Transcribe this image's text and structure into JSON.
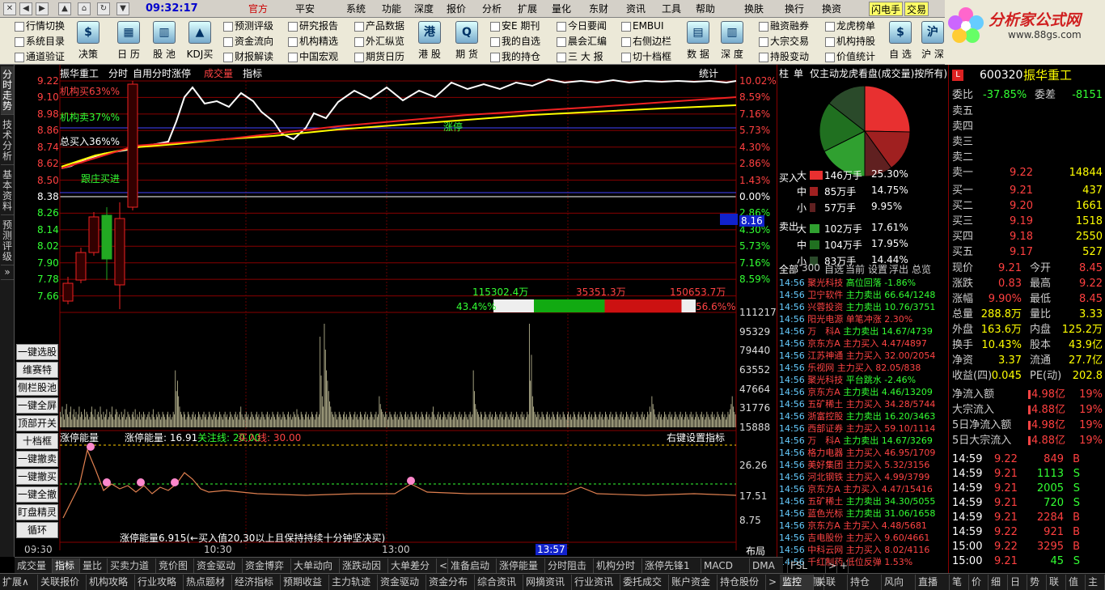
{
  "clock": "09:32:17",
  "menu": [
    {
      "label": "官方",
      "red": true,
      "hl": false
    },
    {
      "label": "平安",
      "red": false,
      "hl": false
    },
    {
      "label": "系统",
      "red": false,
      "hl": false
    },
    {
      "label": "功能",
      "red": false,
      "hl": false
    },
    {
      "label": "深度",
      "red": false,
      "hl": false
    },
    {
      "label": "报价",
      "red": false,
      "hl": false
    },
    {
      "label": "分析",
      "red": false,
      "hl": false
    },
    {
      "label": "扩展",
      "red": false,
      "hl": false
    },
    {
      "label": "量化",
      "red": false,
      "hl": false
    },
    {
      "label": "东财",
      "red": false,
      "hl": false
    },
    {
      "label": "资讯",
      "red": false,
      "hl": false
    },
    {
      "label": "工具",
      "red": false,
      "hl": false
    },
    {
      "label": "帮助",
      "red": false,
      "hl": false
    },
    {
      "label": "换肤",
      "red": false,
      "hl": false
    },
    {
      "label": "换行",
      "red": false,
      "hl": false
    },
    {
      "label": "换资",
      "red": false,
      "hl": false
    },
    {
      "label": "闪电手",
      "red": false,
      "hl": true
    },
    {
      "label": "交易",
      "red": false,
      "hl": true
    }
  ],
  "toolbar": {
    "checks": [
      [
        "行情切换",
        "系统目录",
        "通道验证"
      ],
      [
        "预测评级",
        "资金流向",
        "财报解读"
      ],
      [
        "研究报告",
        "机构精选",
        "中国宏观"
      ],
      [
        "产品数据",
        "外汇纵览",
        "期货日历"
      ],
      [
        "安E 期刊",
        "我的自选",
        "我的持仓"
      ],
      [
        "今日要闻",
        "晨会汇编",
        "三 大 报"
      ],
      [
        "EMBUI",
        "右侧边栏",
        "切十档框"
      ],
      [
        "融资融券",
        "大宗交易",
        "持股变动"
      ],
      [
        "龙虎榜单",
        "机构持股",
        "价值统计"
      ],
      [
        "K 点决策",
        "热点追击"
      ]
    ],
    "big": [
      "决策",
      "日 历",
      "股 池",
      "KDJ买",
      "港 股",
      "期 货",
      "数 据",
      "深 度",
      "自 选",
      "沪 深"
    ],
    "logo_main": "分析家公式网",
    "logo_sub": "www.88gs.com"
  },
  "sidetabs": [
    "分时走势",
    "技术分析",
    "基本资料",
    "预测评级"
  ],
  "leftbtns": [
    "一键选股",
    "维赛特",
    "侧栏股池",
    "一键全屏",
    "顶部开关",
    "十档框",
    "一键撤卖",
    "一键撤买",
    "一键全撤",
    "盯盘精灵",
    "循环N:01"
  ],
  "chart": {
    "header": [
      "振华重工",
      "分时",
      "自用分时涨停",
      "成交量",
      "指标"
    ],
    "stats_label": "统计",
    "price_ticks": [
      "9.22",
      "9.10",
      "8.98",
      "8.86",
      "8.74",
      "8.62",
      "8.50",
      "8.38",
      "8.26",
      "8.14",
      "8.02",
      "7.90",
      "7.78",
      "7.66"
    ],
    "pct_ticks": [
      "10.02%",
      "8.59%",
      "7.16%",
      "5.73%",
      "4.30%",
      "2.86%",
      "1.43%",
      "0.00%",
      "2.86%",
      "4.30%",
      "5.73%",
      "7.16%",
      "8.59%"
    ],
    "current_price": "8.16",
    "annotations": [
      "机构买63%%",
      "机构卖37%%",
      "总买入36%%",
      "跟庄买进",
      "涨停"
    ],
    "bar": {
      "left_val": "115302.4万",
      "mid_val": "35351.3万",
      "right_val": "150653.7万",
      "left_pct": "43.4%%",
      "right_pct": "56.6%%",
      "green_frac": 0.35,
      "red_frac": 0.38
    },
    "vol_ticks": [
      "111217",
      "95329",
      "79440",
      "63552",
      "47664",
      "31776",
      "15888"
    ],
    "vol_values": [
      6,
      4,
      8,
      5,
      3,
      7,
      9,
      5,
      4,
      6,
      8,
      3,
      5,
      7,
      4,
      6,
      3,
      5,
      8,
      4,
      6,
      5,
      3,
      7,
      4,
      6,
      5,
      3,
      4,
      6,
      8,
      5,
      4,
      7,
      3,
      5,
      6,
      4,
      8,
      5,
      3,
      6,
      4,
      5,
      7,
      3,
      4,
      6,
      5,
      8,
      4,
      3,
      5,
      7,
      6,
      4,
      5,
      3,
      6,
      4,
      5,
      7,
      3,
      4,
      6,
      5,
      4,
      3,
      5,
      6,
      4,
      7,
      3,
      5,
      4,
      6,
      3,
      5,
      4,
      6,
      5,
      3,
      4,
      5,
      6,
      4,
      3,
      5,
      7,
      4,
      3,
      5,
      4,
      6,
      5,
      3,
      4,
      6,
      5,
      4,
      3,
      5,
      6,
      4,
      5,
      3,
      4,
      6,
      5,
      22,
      14,
      18,
      12,
      8,
      6,
      5,
      4,
      6,
      5,
      3,
      4,
      6,
      5,
      4,
      3,
      5,
      6,
      4,
      5,
      3,
      4,
      6,
      5,
      4,
      3,
      5,
      6,
      4,
      5,
      3,
      4,
      6,
      5,
      4,
      3,
      5,
      6,
      4,
      5,
      3,
      4,
      6,
      5,
      4,
      3,
      5,
      6,
      4,
      5,
      3,
      4,
      6,
      5,
      4,
      3,
      5,
      6,
      4,
      5,
      3,
      6,
      8,
      5,
      4,
      3,
      5,
      6,
      4,
      5,
      3,
      4,
      6,
      5,
      4,
      3,
      5,
      6,
      4,
      5,
      3,
      4,
      6,
      5,
      4,
      3,
      5,
      6,
      4,
      5,
      3,
      4,
      6,
      5,
      4,
      3,
      5,
      6,
      4,
      5,
      3,
      4,
      6,
      5,
      4,
      3,
      5,
      6,
      4,
      5,
      3,
      4,
      6,
      5,
      4,
      7,
      5,
      4,
      3,
      6,
      5,
      4,
      3,
      5,
      6,
      4,
      5,
      3,
      4,
      6,
      5,
      4,
      3,
      5,
      6,
      4,
      5,
      35,
      20,
      12,
      8,
      40,
      30,
      22,
      18,
      14,
      10,
      8,
      6,
      5,
      4,
      6,
      5,
      3,
      4,
      6,
      5,
      4,
      3,
      5,
      6,
      4,
      5,
      3,
      4,
      6,
      5,
      4,
      3,
      5,
      6,
      4,
      5,
      3,
      4,
      6,
      5,
      4,
      3,
      5,
      6,
      4,
      5,
      3,
      4,
      6,
      5,
      4,
      3,
      5,
      6,
      4,
      5,
      12,
      9,
      7,
      6,
      5,
      4,
      6,
      5,
      3,
      4,
      6,
      5,
      4,
      3,
      5,
      6,
      4,
      5,
      3,
      4,
      6,
      5,
      4,
      3,
      5,
      6,
      4,
      5,
      3,
      4,
      6,
      5,
      4,
      3,
      5,
      6,
      4,
      5,
      3,
      4,
      6,
      5,
      4,
      3,
      5,
      6,
      4,
      5,
      3,
      4,
      6,
      8,
      5,
      4,
      3,
      5,
      6,
      4,
      5,
      3,
      4,
      6,
      5,
      4,
      3,
      5,
      6,
      4,
      5,
      3,
      4,
      6,
      5,
      4,
      3,
      5,
      6,
      4,
      5,
      3,
      4,
      6,
      5,
      4,
      3,
      5,
      6,
      4,
      5,
      22,
      14,
      9,
      7,
      6,
      5,
      4,
      6,
      5,
      3,
      4,
      6,
      5,
      4,
      3,
      5,
      6,
      4,
      5,
      3,
      4,
      6,
      5,
      4,
      3,
      5,
      6,
      4,
      5,
      3,
      4,
      6,
      5,
      4,
      3,
      5,
      6,
      4,
      5,
      3,
      4,
      6,
      5,
      4,
      3,
      5,
      6,
      4,
      5,
      3,
      4,
      6,
      5,
      40,
      18,
      28,
      12,
      8,
      6,
      5,
      4,
      6,
      5,
      3,
      4,
      6,
      5,
      4,
      3,
      5,
      6,
      4,
      5,
      3,
      4,
      6,
      5,
      4,
      3,
      5,
      6,
      4,
      5,
      3,
      4,
      6,
      5,
      4,
      3,
      5,
      6,
      4,
      5,
      3,
      4,
      6,
      5,
      4,
      3,
      5,
      6,
      4,
      5,
      3,
      4,
      6,
      5,
      4,
      3,
      5,
      6,
      4,
      5,
      3,
      4,
      6,
      5,
      4,
      3,
      5,
      6,
      4,
      5,
      3,
      4,
      6,
      5,
      4,
      3,
      5,
      6,
      4,
      5,
      3,
      4,
      6,
      5,
      4,
      3,
      5,
      6,
      4,
      5,
      3,
      4,
      6,
      5,
      4,
      3,
      5,
      6,
      4,
      5,
      3,
      4,
      6,
      5,
      4,
      3,
      5,
      6,
      4,
      5,
      3,
      4,
      6,
      5,
      8,
      6,
      12,
      9,
      7,
      5,
      4,
      3,
      5,
      6,
      4,
      5,
      3,
      4,
      6,
      5,
      4,
      3,
      5,
      6,
      4,
      5,
      3,
      4,
      6,
      5,
      4,
      3,
      5,
      6,
      4,
      5,
      3,
      4,
      6,
      5,
      4,
      3,
      5,
      6,
      4,
      5,
      3,
      4,
      6,
      5,
      4,
      3,
      5,
      6,
      4,
      5,
      3,
      4,
      6,
      5,
      4,
      3,
      5,
      6,
      4,
      5,
      3,
      4,
      6,
      5,
      4,
      3,
      5,
      6,
      4,
      5,
      3,
      4,
      6,
      5,
      7,
      9,
      12,
      8,
      6,
      5
    ],
    "ind_header": [
      "涨停能量",
      "涨停能量: 16.91",
      "关注线: 20.00",
      "买入线: 30.00"
    ],
    "ind_right": "右键设置指标",
    "ind_ticks": [
      "26.26",
      "17.51",
      "8.75"
    ],
    "ind_note": "涨停能量6.915(←买入值20,30以上且保持持续十分钟坚决买)",
    "time_labels": [
      "09:30",
      "10:30",
      "13:00",
      "13:57"
    ],
    "layout_label": "布局"
  },
  "midpanel": {
    "tabs": [
      "柱",
      "单",
      "仅主动",
      "龙虎看盘(成交量)按所有)"
    ],
    "pie": [
      {
        "value": 25.3,
        "color": "#e83030"
      },
      {
        "value": 14.75,
        "color": "#a02020"
      },
      {
        "value": 9.95,
        "color": "#602020"
      },
      {
        "value": 17.61,
        "color": "#30a030"
      },
      {
        "value": 17.95,
        "color": "#207020"
      },
      {
        "value": 14.44,
        "color": "#2a4a2a"
      }
    ],
    "buy_label": [
      "买",
      "入"
    ],
    "sell_label": [
      "卖",
      "出"
    ],
    "rows": [
      {
        "side": "大",
        "amount": "146万手",
        "pct": "25.30%",
        "frac": 0.9,
        "color": "#e83030"
      },
      {
        "side": "中",
        "amount": "85万手",
        "pct": "14.75%",
        "frac": 0.5,
        "color": "#a02020"
      },
      {
        "side": "小",
        "amount": "57万手",
        "pct": "9.95%",
        "frac": 0.34,
        "color": "#602020"
      },
      {
        "side": "大",
        "amount": "102万手",
        "pct": "17.61%",
        "frac": 0.62,
        "color": "#30a030"
      },
      {
        "side": "中",
        "amount": "104万手",
        "pct": "17.95%",
        "frac": 0.64,
        "color": "#207020"
      },
      {
        "side": "小",
        "amount": "83万手",
        "pct": "14.44%",
        "frac": 0.51,
        "color": "#2a4a2a"
      }
    ],
    "filters": [
      "全部",
      "300",
      "自选",
      "当前",
      "设置",
      "浮出",
      "总览"
    ],
    "monitor": [
      {
        "time": "14:56",
        "name": "聚光科技",
        "act": "高位回落",
        "val": "-1.86%",
        "c": "#3f3"
      },
      {
        "time": "14:56",
        "name": "卫宁软件",
        "act": "主力卖出",
        "val": "66.64/1248",
        "c": "#3f3"
      },
      {
        "time": "14:56",
        "name": "兴蓉投资",
        "act": "主力卖出",
        "val": "10.76/3751",
        "c": "#3f3"
      },
      {
        "time": "14:56",
        "name": "阳光电源",
        "act": "单笔冲涨",
        "val": "2.30%",
        "c": "#f44"
      },
      {
        "time": "14:56",
        "name": "万　科A",
        "act": "主力卖出",
        "val": "14.67/4739",
        "c": "#3f3"
      },
      {
        "time": "14:56",
        "name": "京东方A",
        "act": "主力买入",
        "val": "4.47/4897",
        "c": "#f44"
      },
      {
        "time": "14:56",
        "name": "江苏神通",
        "act": "主力买入",
        "val": "32.00/2054",
        "c": "#f44"
      },
      {
        "time": "14:56",
        "name": "乐视网",
        "act": "主力买入",
        "val": "82.05/838",
        "c": "#f44"
      },
      {
        "time": "14:56",
        "name": "聚光科技",
        "act": "平台跳水",
        "val": "-2.46%",
        "c": "#3f3"
      },
      {
        "time": "14:56",
        "name": "京东方A",
        "act": "主力卖出",
        "val": "4.46/13209",
        "c": "#3f3"
      },
      {
        "time": "14:56",
        "name": "五矿稀土",
        "act": "主力买入",
        "val": "34.28/5744",
        "c": "#f44"
      },
      {
        "time": "14:56",
        "name": "浙富控股",
        "act": "主力卖出",
        "val": "16.20/3463",
        "c": "#3f3"
      },
      {
        "time": "14:56",
        "name": "西部证券",
        "act": "主力买入",
        "val": "59.10/1114",
        "c": "#f44"
      },
      {
        "time": "14:56",
        "name": "万　科A",
        "act": "主力卖出",
        "val": "14.67/3269",
        "c": "#3f3"
      },
      {
        "time": "14:56",
        "name": "格力电器",
        "act": "主力买入",
        "val": "46.95/1709",
        "c": "#f44"
      },
      {
        "time": "14:56",
        "name": "美好集团",
        "act": "主力买入",
        "val": "5.32/3156",
        "c": "#f44"
      },
      {
        "time": "14:56",
        "name": "河北钢铁",
        "act": "主力买入",
        "val": "4.99/3799",
        "c": "#f44"
      },
      {
        "time": "14:56",
        "name": "京东方A",
        "act": "主力买入",
        "val": "4.47/15416",
        "c": "#f44"
      },
      {
        "time": "14:56",
        "name": "五矿稀土",
        "act": "主力卖出",
        "val": "34.30/5055",
        "c": "#3f3"
      },
      {
        "time": "14:56",
        "name": "蓝色光标",
        "act": "主力卖出",
        "val": "31.06/1658",
        "c": "#3f3"
      },
      {
        "time": "14:56",
        "name": "京东方A",
        "act": "主力买入",
        "val": "4.48/5681",
        "c": "#f44"
      },
      {
        "time": "14:56",
        "name": "吉电股份",
        "act": "主力买入",
        "val": "9.60/4661",
        "c": "#f44"
      },
      {
        "time": "14:56",
        "name": "中科云网",
        "act": "主力买入",
        "val": "8.02/4116",
        "c": "#f44"
      },
      {
        "time": "14:56",
        "name": "千红制药",
        "act": "低位反弹",
        "val": "1.53%",
        "c": "#f44"
      }
    ]
  },
  "quote": {
    "code": "600320",
    "name": "振华重工",
    "wb": {
      "label": "委比",
      "val": "-37.85%",
      "label2": "委差",
      "val2": "-8151"
    },
    "asks": [
      {
        "l": "卖五",
        "p": "",
        "v": ""
      },
      {
        "l": "卖四",
        "p": "",
        "v": ""
      },
      {
        "l": "卖三",
        "p": "",
        "v": ""
      },
      {
        "l": "卖二",
        "p": "",
        "v": ""
      },
      {
        "l": "卖一",
        "p": "9.22",
        "v": "14844"
      }
    ],
    "bids": [
      {
        "l": "买一",
        "p": "9.21",
        "v": "437"
      },
      {
        "l": "买二",
        "p": "9.20",
        "v": "1661"
      },
      {
        "l": "买三",
        "p": "9.19",
        "v": "1518"
      },
      {
        "l": "买四",
        "p": "9.18",
        "v": "2550"
      },
      {
        "l": "买五",
        "p": "9.17",
        "v": "527"
      }
    ],
    "stats": [
      [
        "现价",
        "9.21",
        "今开",
        "8.45"
      ],
      [
        "涨跌",
        "0.83",
        "最高",
        "9.22"
      ],
      [
        "涨幅",
        "9.90%",
        "最低",
        "8.45"
      ],
      [
        "总量",
        "288.8万",
        "量比",
        "3.33"
      ],
      [
        "外盘",
        "163.6万",
        "内盘",
        "125.2万"
      ],
      [
        "换手",
        "10.43%",
        "股本",
        "43.9亿"
      ],
      [
        "净资",
        "3.37",
        "流通",
        "27.7亿"
      ],
      [
        "收益(四)",
        "0.045",
        "PE(动)",
        "202.8"
      ]
    ],
    "flows": [
      [
        "净流入额",
        "4.98亿",
        "19%"
      ],
      [
        "大宗流入",
        "4.88亿",
        "19%"
      ],
      [
        "5日净流入额",
        "4.98亿",
        "19%"
      ],
      [
        "5日大宗流入",
        "4.88亿",
        "19%"
      ]
    ],
    "ticks": [
      [
        "14:59",
        "9.22",
        "849",
        "B"
      ],
      [
        "14:59",
        "9.21",
        "1113",
        "S"
      ],
      [
        "14:59",
        "9.21",
        "2005",
        "S"
      ],
      [
        "14:59",
        "9.21",
        "720",
        "S"
      ],
      [
        "14:59",
        "9.21",
        "2284",
        "B"
      ],
      [
        "14:59",
        "9.22",
        "921",
        "B"
      ],
      [
        "15:00",
        "9.22",
        "3295",
        "B"
      ],
      [
        "15:00",
        "9.21",
        "45",
        "S"
      ]
    ]
  },
  "bottomtabs": [
    "成交量",
    "指标",
    "量比",
    "买卖力道",
    "竞价图",
    "资金驱动",
    "资金博弈",
    "大单动向",
    "涨跌动因",
    "大单差分",
    "<",
    "准备启动",
    "涨停能量",
    "分时阻击",
    "机构分时",
    "涨停先锋1",
    "MACD",
    "DMA",
    "FSL",
    ">",
    "+"
  ],
  "statusbar": [
    "扩展∧",
    "关联报价",
    "机构攻略",
    "行业攻略",
    "热点题材",
    "经济指标",
    "预期收益",
    "主力轨迹",
    "资金驱动",
    "资金分布",
    "综合资讯",
    "网摘资讯",
    "行业资讯",
    "委托成交",
    "账户资金",
    "持仓股份",
    ">",
    "设",
    "抬",
    "侧"
  ],
  "statusright": [
    "监控",
    "关联",
    "持仓",
    "风向",
    "直播",
    "笔",
    "价",
    "细",
    "日",
    "势",
    "联",
    "值",
    "主"
  ]
}
